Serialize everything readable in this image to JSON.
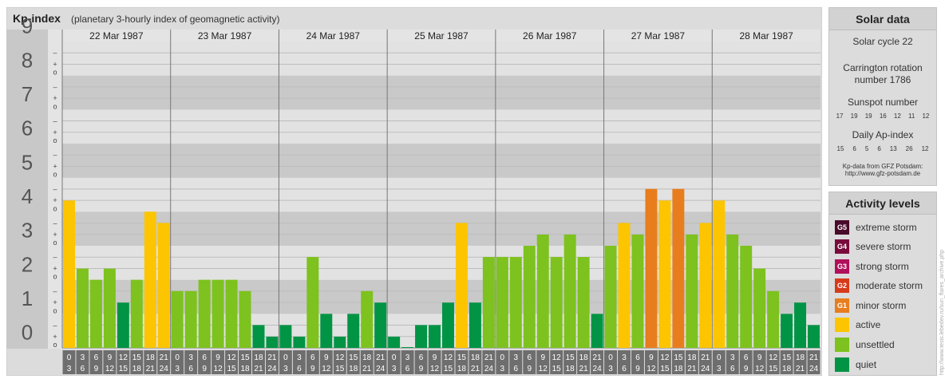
{
  "header": {
    "title": "Kp-index",
    "subtitle": "(planetary 3-hourly index of geomagnetic activity)"
  },
  "chart_data": {
    "type": "bar",
    "title": "Kp-index",
    "subtitle": "(planetary 3-hourly index of geomagnetic activity)",
    "ylim": [
      0,
      9
    ],
    "y_ticks": [
      "0",
      "1",
      "2",
      "3",
      "4",
      "5",
      "6",
      "7",
      "8",
      "9"
    ],
    "minor_tick_labels": [
      "o",
      "+",
      "–"
    ],
    "days": [
      "22 Mar 1987",
      "23 Mar 1987",
      "24 Mar 1987",
      "25 Mar 1987",
      "26 Mar 1987",
      "27 Mar 1987",
      "28 Mar 1987"
    ],
    "interval_labels": [
      [
        "0",
        "3"
      ],
      [
        "3",
        "6"
      ],
      [
        "6",
        "9"
      ],
      [
        "9",
        "12"
      ],
      [
        "12",
        "15"
      ],
      [
        "15",
        "18"
      ],
      [
        "18",
        "21"
      ],
      [
        "21",
        "24"
      ]
    ],
    "values": [
      4.33,
      2.33,
      2.0,
      2.33,
      1.33,
      2.0,
      4.0,
      3.67,
      1.67,
      1.67,
      2.0,
      2.0,
      2.0,
      1.67,
      0.67,
      0.33,
      0.67,
      0.33,
      2.67,
      1.0,
      0.33,
      1.0,
      1.67,
      1.33,
      0.33,
      0.0,
      0.67,
      0.67,
      1.33,
      3.67,
      1.33,
      2.67,
      2.67,
      2.67,
      3.0,
      3.33,
      2.67,
      3.33,
      2.67,
      1.0,
      3.0,
      3.67,
      3.33,
      4.67,
      4.33,
      4.67,
      3.33,
      3.67,
      4.33,
      3.33,
      3.0,
      2.33,
      1.67,
      1.0,
      1.33,
      0.67
    ],
    "grid": true
  },
  "solar": {
    "title": "Solar data",
    "cycle": "Solar cycle 22",
    "carrington_line1": "Carrington rotation",
    "carrington_line2": "number 1786",
    "sunspot_label": "Sunspot number",
    "sunspot_values": [
      "17",
      "19",
      "19",
      "16",
      "12",
      "11",
      "12"
    ],
    "ap_label": "Daily Ap-index",
    "ap_values": [
      "15",
      "6",
      "5",
      "6",
      "13",
      "26",
      "12"
    ],
    "credit_line1": "Kp-data from GFZ Potsdam:",
    "credit_line2": "http://www.gfz-potsdam.de"
  },
  "activity": {
    "title": "Activity levels",
    "levels": [
      {
        "badge": "G5",
        "label": "extreme storm",
        "color": "#4a0a2a"
      },
      {
        "badge": "G4",
        "label": "severe storm",
        "color": "#7a0a3c"
      },
      {
        "badge": "G3",
        "label": "strong storm",
        "color": "#b0105a"
      },
      {
        "badge": "G2",
        "label": "moderate storm",
        "color": "#d63a1a"
      },
      {
        "badge": "G1",
        "label": "minor storm",
        "color": "#e87d1e"
      },
      {
        "badge": "",
        "label": "active",
        "color": "#fcc500"
      },
      {
        "badge": "",
        "label": "unsettled",
        "color": "#7dc21e"
      },
      {
        "badge": "",
        "label": "quiet",
        "color": "#009444"
      }
    ]
  },
  "watermark": "http://www.tesis.lebedev.ru/sun_flares_archive.php"
}
